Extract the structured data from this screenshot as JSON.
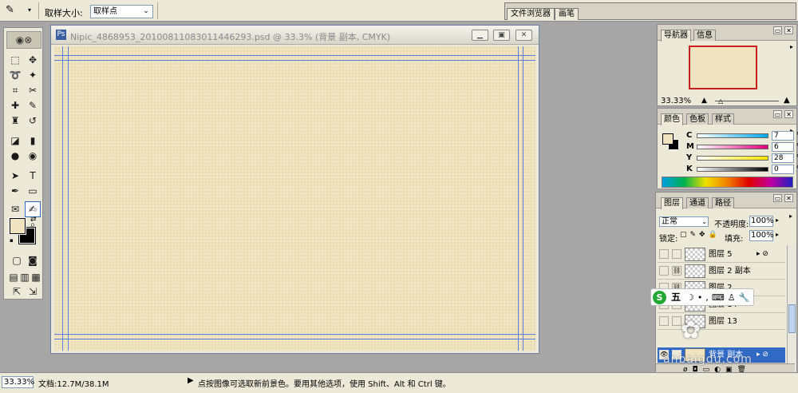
{
  "options_bar": {
    "tool_icon": "eyedropper-icon",
    "sample_size_label": "取样大小:",
    "sample_size_value": "取样点",
    "well_tabs": [
      "文件浏览器",
      "画笔"
    ]
  },
  "toolbox": {
    "logo": "ps-eye-logo",
    "tools": [
      "marquee",
      "move",
      "lasso",
      "magic-wand",
      "crop",
      "slice",
      "healing-brush",
      "brush",
      "clone-stamp",
      "history-brush",
      "eraser",
      "gradient",
      "blur",
      "dodge",
      "path-select",
      "type",
      "pen",
      "shape",
      "notes",
      "eyedropper",
      "hand",
      "zoom"
    ],
    "selected_tool": "eyedropper",
    "foreground_color": "#f0e4c0",
    "background_color": "#000000"
  },
  "document": {
    "title": "Nipic_4868953_20100811083011446293.psd @ 33.3% (背景 副本, CMYK)",
    "canvas_color": "#efe3bd",
    "guide_color": "#5b7ee0"
  },
  "navigator_panel": {
    "tabs": [
      "导航器",
      "信息"
    ],
    "zoom": "33.33%"
  },
  "color_panel": {
    "tabs": [
      "颜色",
      "色板",
      "样式"
    ],
    "channels": [
      {
        "label": "C",
        "value": "7",
        "unit": "%"
      },
      {
        "label": "M",
        "value": "6",
        "unit": "%"
      },
      {
        "label": "Y",
        "value": "28",
        "unit": "%"
      },
      {
        "label": "K",
        "value": "0",
        "unit": "%"
      }
    ]
  },
  "layers_panel": {
    "tabs": [
      "图层",
      "通道",
      "路径"
    ],
    "blend_mode": "正常",
    "opacity_label": "不透明度:",
    "opacity_value": "100%",
    "lock_label": "锁定:",
    "fill_label": "填充:",
    "fill_value": "100%",
    "layers": [
      {
        "name": "图层 5",
        "fx": true,
        "selected": false
      },
      {
        "name": "图层 2 副本",
        "fx": false,
        "selected": false
      },
      {
        "name": "图层 2",
        "fx": false,
        "selected": false
      },
      {
        "name": "图层 14",
        "fx": false,
        "selected": false
      },
      {
        "name": "图层 13",
        "fx": false,
        "selected": false
      },
      {
        "name": "背景 副本",
        "fx": true,
        "selected": true
      }
    ]
  },
  "ime_toolbar": {
    "mode": "五"
  },
  "status_bar": {
    "zoom": "33.33%",
    "doc_info": "文档:12.7M/38.1M",
    "hint": "点按图像可选取新前景色。要用其他选项，使用 Shift、Alt 和 Ctrl 键。"
  },
  "watermark": {
    "text": "anbaigdu.com"
  }
}
